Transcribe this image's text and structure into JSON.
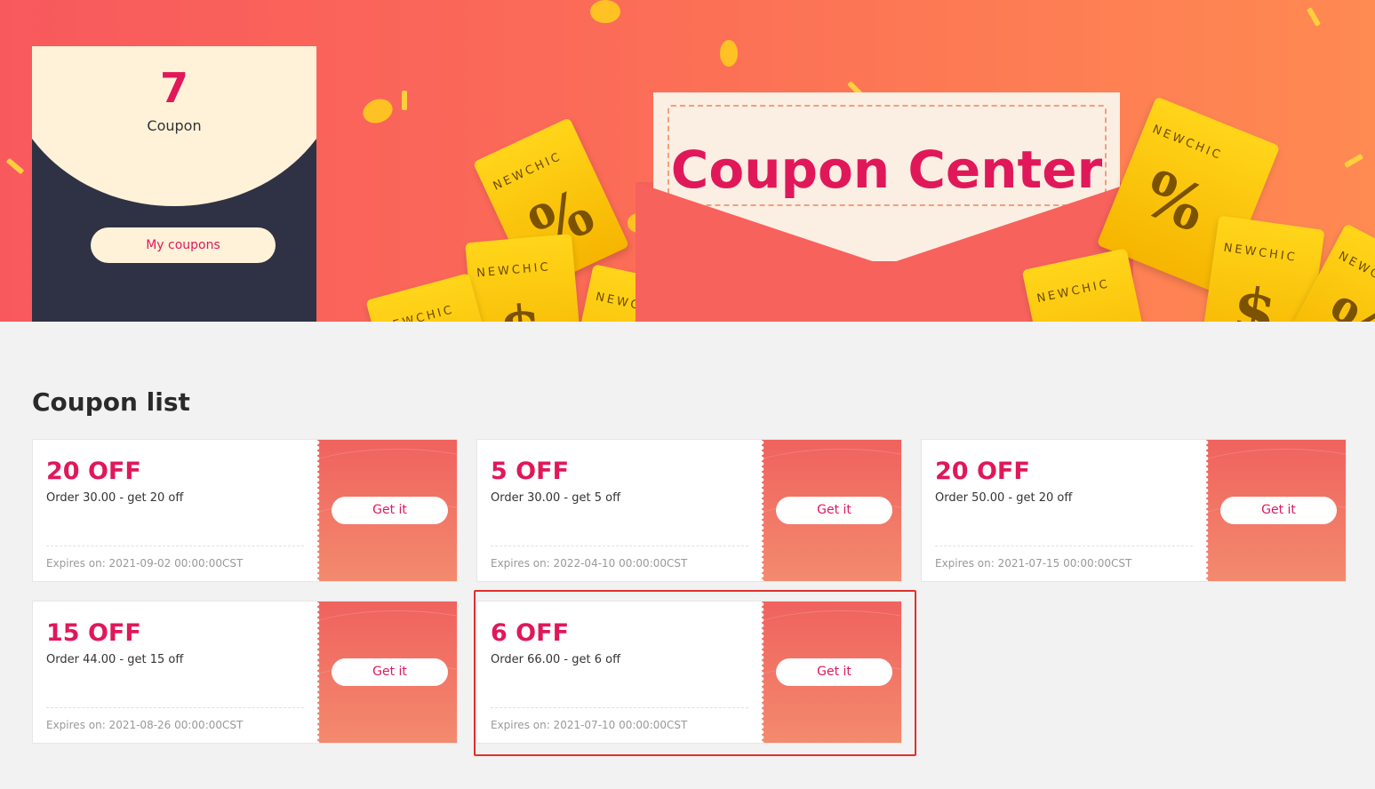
{
  "header": {
    "coupon_count": "7",
    "coupon_count_label": "Coupon",
    "my_coupons_label": "My coupons",
    "title": "Coupon Center",
    "ticket_brand": "NEWCHIC"
  },
  "coupon_list": {
    "title": "Coupon list",
    "get_label": "Get it",
    "items": [
      {
        "amount": "20 OFF",
        "desc": "Order 30.00 - get 20 off",
        "expires": "Expires on: 2021-09-02 00:00:00CST"
      },
      {
        "amount": "5 OFF",
        "desc": "Order 30.00 - get 5 off",
        "expires": "Expires on: 2022-04-10 00:00:00CST"
      },
      {
        "amount": "20 OFF",
        "desc": "Order 50.00 - get 20 off",
        "expires": "Expires on: 2021-07-15 00:00:00CST"
      },
      {
        "amount": "15 OFF",
        "desc": "Order 44.00 - get 15 off",
        "expires": "Expires on: 2021-08-26 00:00:00CST"
      },
      {
        "amount": "6 OFF",
        "desc": "Order 66.00 - get 6 off",
        "expires": "Expires on: 2021-07-10 00:00:00CST"
      }
    ]
  },
  "colors": {
    "accent": "#e0185a",
    "highlight": "#e0302a",
    "banner": "#f8595d"
  }
}
